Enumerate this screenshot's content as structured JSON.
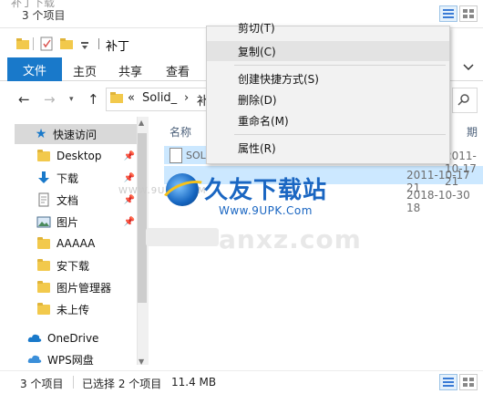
{
  "prev_window": {
    "ghost_title": "补丁下载",
    "item_count": "3 个项目"
  },
  "title": {
    "folder_name": "补丁"
  },
  "ribbon": {
    "file_tab": "文件",
    "tabs": [
      "主页",
      "共享",
      "查看"
    ]
  },
  "address": {
    "prefix": "«",
    "segment": "Solid_",
    "sep": "›",
    "partial": "补"
  },
  "nav": {
    "items": [
      {
        "label": "快速访问",
        "icon": "star-icon",
        "selected": true
      },
      {
        "label": "Desktop",
        "icon": "folder-icon",
        "pinned": true
      },
      {
        "label": "下载",
        "icon": "download-arrow-icon",
        "pinned": true
      },
      {
        "label": "文档",
        "icon": "document-icon",
        "pinned": true
      },
      {
        "label": "图片",
        "icon": "picture-icon",
        "pinned": true
      },
      {
        "label": "AAAAA",
        "icon": "folder-icon"
      },
      {
        "label": "安下载",
        "icon": "folder-icon"
      },
      {
        "label": "图片管理器",
        "icon": "folder-icon"
      },
      {
        "label": "未上传",
        "icon": "folder-icon"
      },
      {
        "label": "OneDrive",
        "icon": "cloud-icon"
      },
      {
        "label": "WPS网盘",
        "icon": "cloud-icon"
      }
    ]
  },
  "files": {
    "col_name": "名称",
    "col_right": "期",
    "partial_name": "SOL",
    "dates": [
      "2011-10-17 21",
      "2011-10-17 21",
      "2018-10-30 18"
    ]
  },
  "watermark": {
    "url_small": "WWW.9UPK.COM",
    "brand": "久友下载站",
    "brand_url": "Www.9UPK.Com",
    "faded": "anxz.com"
  },
  "status": {
    "count": "3 个项目",
    "selected": "已选择 2 个项目",
    "size": "11.4 MB"
  },
  "context_menu": {
    "cut_partial": "剪切(T)",
    "copy": "复制(C)",
    "shortcut": "创建快捷方式(S)",
    "delete": "删除(D)",
    "rename": "重命名(M)",
    "properties": "属性(R)"
  },
  "colors": {
    "accent": "#1979ca",
    "selection": "#cce8ff",
    "folder": "#f2c94c"
  }
}
